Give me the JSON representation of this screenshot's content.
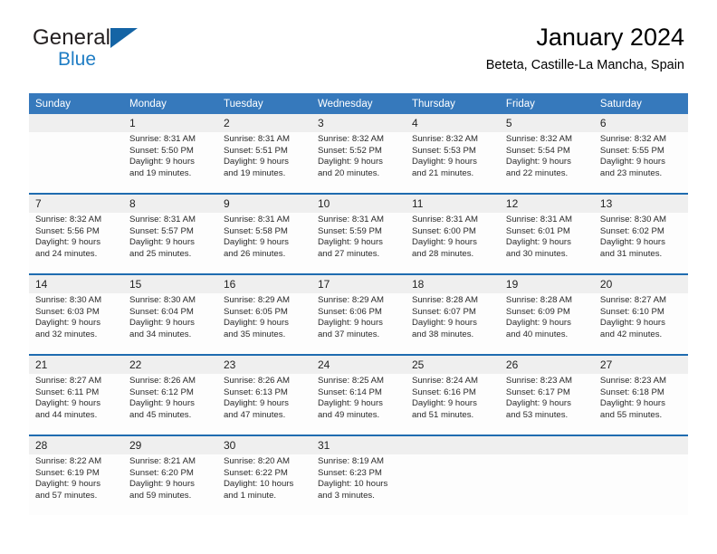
{
  "brand": {
    "word1": "General",
    "word2": "Blue",
    "triangle_color": "#1464a5",
    "blue_text_color": "#1f7dc4"
  },
  "header": {
    "title": "January 2024",
    "subtitle": "Beteta, Castille-La Mancha, Spain",
    "header_bg": "#3679bc",
    "separator_color": "#1f6cb0",
    "daynum_bg": "#efefef"
  },
  "weekday_headers": [
    "Sunday",
    "Monday",
    "Tuesday",
    "Wednesday",
    "Thursday",
    "Friday",
    "Saturday"
  ],
  "weeks": [
    {
      "days": [
        {
          "num": "",
          "lines": []
        },
        {
          "num": "1",
          "lines": [
            "Sunrise: 8:31 AM",
            "Sunset: 5:50 PM",
            "Daylight: 9 hours",
            "and 19 minutes."
          ]
        },
        {
          "num": "2",
          "lines": [
            "Sunrise: 8:31 AM",
            "Sunset: 5:51 PM",
            "Daylight: 9 hours",
            "and 19 minutes."
          ]
        },
        {
          "num": "3",
          "lines": [
            "Sunrise: 8:32 AM",
            "Sunset: 5:52 PM",
            "Daylight: 9 hours",
            "and 20 minutes."
          ]
        },
        {
          "num": "4",
          "lines": [
            "Sunrise: 8:32 AM",
            "Sunset: 5:53 PM",
            "Daylight: 9 hours",
            "and 21 minutes."
          ]
        },
        {
          "num": "5",
          "lines": [
            "Sunrise: 8:32 AM",
            "Sunset: 5:54 PM",
            "Daylight: 9 hours",
            "and 22 minutes."
          ]
        },
        {
          "num": "6",
          "lines": [
            "Sunrise: 8:32 AM",
            "Sunset: 5:55 PM",
            "Daylight: 9 hours",
            "and 23 minutes."
          ]
        }
      ]
    },
    {
      "days": [
        {
          "num": "7",
          "lines": [
            "Sunrise: 8:32 AM",
            "Sunset: 5:56 PM",
            "Daylight: 9 hours",
            "and 24 minutes."
          ]
        },
        {
          "num": "8",
          "lines": [
            "Sunrise: 8:31 AM",
            "Sunset: 5:57 PM",
            "Daylight: 9 hours",
            "and 25 minutes."
          ]
        },
        {
          "num": "9",
          "lines": [
            "Sunrise: 8:31 AM",
            "Sunset: 5:58 PM",
            "Daylight: 9 hours",
            "and 26 minutes."
          ]
        },
        {
          "num": "10",
          "lines": [
            "Sunrise: 8:31 AM",
            "Sunset: 5:59 PM",
            "Daylight: 9 hours",
            "and 27 minutes."
          ]
        },
        {
          "num": "11",
          "lines": [
            "Sunrise: 8:31 AM",
            "Sunset: 6:00 PM",
            "Daylight: 9 hours",
            "and 28 minutes."
          ]
        },
        {
          "num": "12",
          "lines": [
            "Sunrise: 8:31 AM",
            "Sunset: 6:01 PM",
            "Daylight: 9 hours",
            "and 30 minutes."
          ]
        },
        {
          "num": "13",
          "lines": [
            "Sunrise: 8:30 AM",
            "Sunset: 6:02 PM",
            "Daylight: 9 hours",
            "and 31 minutes."
          ]
        }
      ]
    },
    {
      "days": [
        {
          "num": "14",
          "lines": [
            "Sunrise: 8:30 AM",
            "Sunset: 6:03 PM",
            "Daylight: 9 hours",
            "and 32 minutes."
          ]
        },
        {
          "num": "15",
          "lines": [
            "Sunrise: 8:30 AM",
            "Sunset: 6:04 PM",
            "Daylight: 9 hours",
            "and 34 minutes."
          ]
        },
        {
          "num": "16",
          "lines": [
            "Sunrise: 8:29 AM",
            "Sunset: 6:05 PM",
            "Daylight: 9 hours",
            "and 35 minutes."
          ]
        },
        {
          "num": "17",
          "lines": [
            "Sunrise: 8:29 AM",
            "Sunset: 6:06 PM",
            "Daylight: 9 hours",
            "and 37 minutes."
          ]
        },
        {
          "num": "18",
          "lines": [
            "Sunrise: 8:28 AM",
            "Sunset: 6:07 PM",
            "Daylight: 9 hours",
            "and 38 minutes."
          ]
        },
        {
          "num": "19",
          "lines": [
            "Sunrise: 8:28 AM",
            "Sunset: 6:09 PM",
            "Daylight: 9 hours",
            "and 40 minutes."
          ]
        },
        {
          "num": "20",
          "lines": [
            "Sunrise: 8:27 AM",
            "Sunset: 6:10 PM",
            "Daylight: 9 hours",
            "and 42 minutes."
          ]
        }
      ]
    },
    {
      "days": [
        {
          "num": "21",
          "lines": [
            "Sunrise: 8:27 AM",
            "Sunset: 6:11 PM",
            "Daylight: 9 hours",
            "and 44 minutes."
          ]
        },
        {
          "num": "22",
          "lines": [
            "Sunrise: 8:26 AM",
            "Sunset: 6:12 PM",
            "Daylight: 9 hours",
            "and 45 minutes."
          ]
        },
        {
          "num": "23",
          "lines": [
            "Sunrise: 8:26 AM",
            "Sunset: 6:13 PM",
            "Daylight: 9 hours",
            "and 47 minutes."
          ]
        },
        {
          "num": "24",
          "lines": [
            "Sunrise: 8:25 AM",
            "Sunset: 6:14 PM",
            "Daylight: 9 hours",
            "and 49 minutes."
          ]
        },
        {
          "num": "25",
          "lines": [
            "Sunrise: 8:24 AM",
            "Sunset: 6:16 PM",
            "Daylight: 9 hours",
            "and 51 minutes."
          ]
        },
        {
          "num": "26",
          "lines": [
            "Sunrise: 8:23 AM",
            "Sunset: 6:17 PM",
            "Daylight: 9 hours",
            "and 53 minutes."
          ]
        },
        {
          "num": "27",
          "lines": [
            "Sunrise: 8:23 AM",
            "Sunset: 6:18 PM",
            "Daylight: 9 hours",
            "and 55 minutes."
          ]
        }
      ]
    },
    {
      "days": [
        {
          "num": "28",
          "lines": [
            "Sunrise: 8:22 AM",
            "Sunset: 6:19 PM",
            "Daylight: 9 hours",
            "and 57 minutes."
          ]
        },
        {
          "num": "29",
          "lines": [
            "Sunrise: 8:21 AM",
            "Sunset: 6:20 PM",
            "Daylight: 9 hours",
            "and 59 minutes."
          ]
        },
        {
          "num": "30",
          "lines": [
            "Sunrise: 8:20 AM",
            "Sunset: 6:22 PM",
            "Daylight: 10 hours",
            "and 1 minute."
          ]
        },
        {
          "num": "31",
          "lines": [
            "Sunrise: 8:19 AM",
            "Sunset: 6:23 PM",
            "Daylight: 10 hours",
            "and 3 minutes."
          ]
        },
        {
          "num": "",
          "lines": []
        },
        {
          "num": "",
          "lines": []
        },
        {
          "num": "",
          "lines": []
        }
      ]
    }
  ]
}
